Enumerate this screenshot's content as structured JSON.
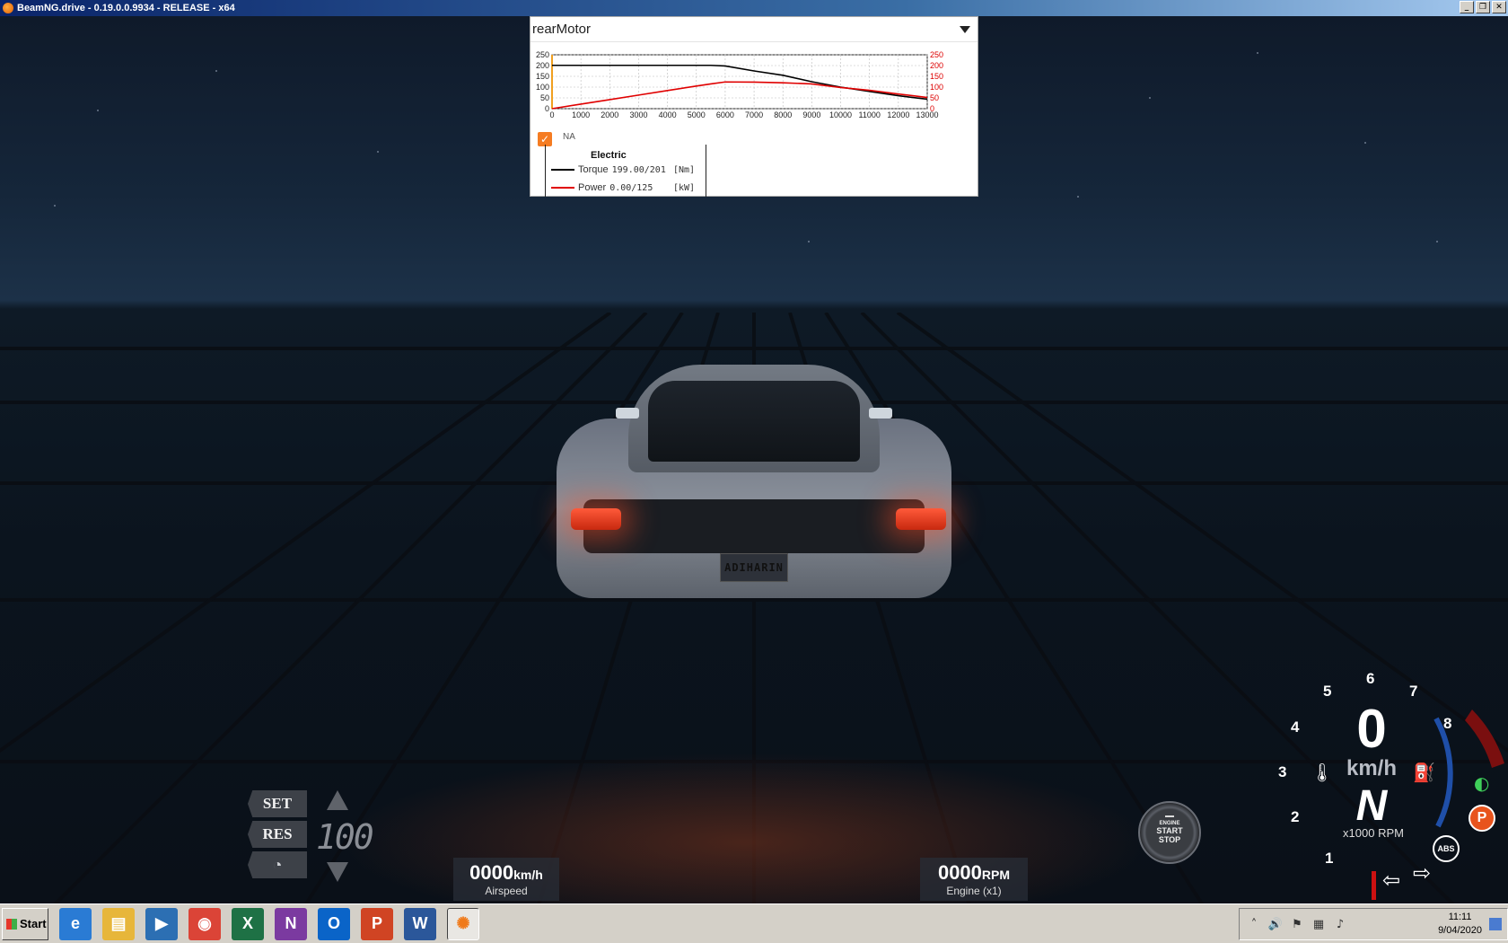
{
  "window": {
    "title": "BeamNG.drive - 0.19.0.0.9934 - RELEASE - x64",
    "minimize": "_",
    "restore": "❐",
    "close": "✕"
  },
  "scene": {
    "plate_text": "ADIHARIN"
  },
  "torque_widget": {
    "selector_value": "rearMotor",
    "checkbox_label": "NA",
    "checkbox_checked": true,
    "legend_title": "Electric",
    "legend": [
      {
        "label": "Torque",
        "value": "199.00/201",
        "unit": "[Nm]",
        "color": "#000000"
      },
      {
        "label": "Power",
        "value": "0.00/125",
        "unit": "[kW]",
        "color": "#e00000"
      }
    ]
  },
  "chart_data": {
    "type": "line",
    "x": [
      0,
      1000,
      2000,
      3000,
      4000,
      5000,
      5500,
      6000,
      7000,
      8000,
      9000,
      10000,
      11000,
      12000,
      13000
    ],
    "xlim": [
      0,
      13000
    ],
    "xticks": [
      "0",
      "1000",
      "2000",
      "3000",
      "4000",
      "5000",
      "6000",
      "7000",
      "8000",
      "9000",
      "10000",
      "11000",
      "12000",
      "13000"
    ],
    "ylim_left": [
      0,
      250
    ],
    "ylim_right": [
      0,
      250
    ],
    "yticks": [
      "0",
      "50",
      "100",
      "150",
      "200",
      "250"
    ],
    "grid": true,
    "series": [
      {
        "name": "Torque",
        "color": "#000000",
        "axis": "left",
        "values": [
          201,
          201,
          201,
          201,
          201,
          201,
          201,
          198,
          175,
          155,
          125,
          100,
          80,
          60,
          44
        ]
      },
      {
        "name": "Power",
        "color": "#e00000",
        "axis": "right",
        "values": [
          0,
          21,
          42,
          63,
          84,
          105,
          115,
          124,
          123,
          120,
          115,
          98,
          85,
          68,
          52
        ]
      }
    ],
    "marker_x": 0
  },
  "cruise": {
    "set_label": "SET",
    "res_label": "RES",
    "speed": "100"
  },
  "airspeed": {
    "value": "0000",
    "unit": "km/h",
    "label": "Airspeed"
  },
  "engine": {
    "value": "0000",
    "unit": "RPM",
    "label": "Engine (x1)"
  },
  "start_button": {
    "line1": "ENGINE",
    "line2": "START",
    "line3": "STOP"
  },
  "gauge": {
    "speed": "0",
    "unit": "km/h",
    "gear": "N",
    "rpm_label": "x1000 RPM",
    "numbers": [
      "1",
      "2",
      "3",
      "4",
      "5",
      "6",
      "7",
      "8"
    ],
    "park": "P",
    "abs": "ABS"
  },
  "taskbar": {
    "start_label": "Start",
    "apps": [
      {
        "name": "internet-explorer",
        "glyph": "e",
        "color": "#2a7bd4"
      },
      {
        "name": "file-explorer",
        "glyph": "▤",
        "color": "#e7b63a"
      },
      {
        "name": "media-player",
        "glyph": "▶",
        "color": "#2c6fb3"
      },
      {
        "name": "chrome",
        "glyph": "◉",
        "color": "#db4437"
      },
      {
        "name": "excel",
        "glyph": "X",
        "color": "#1e7145"
      },
      {
        "name": "onenote",
        "glyph": "N",
        "color": "#7b3aa0"
      },
      {
        "name": "outlook",
        "glyph": "O",
        "color": "#0a64c8"
      },
      {
        "name": "powerpoint",
        "glyph": "P",
        "color": "#d04423"
      },
      {
        "name": "word",
        "glyph": "W",
        "color": "#2b579a"
      },
      {
        "name": "beamng",
        "glyph": "✺",
        "color": "#f07a1a"
      }
    ],
    "clock_time": "11:11",
    "clock_date": "9/04/2020"
  }
}
